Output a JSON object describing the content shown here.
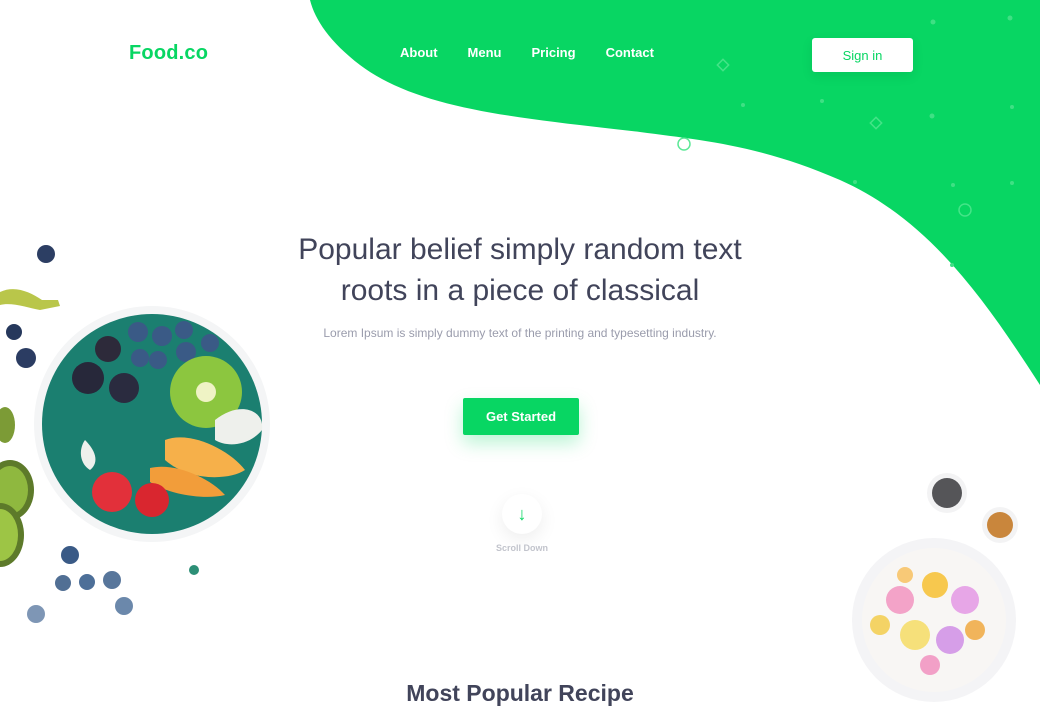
{
  "theme": {
    "accent": "#08d663"
  },
  "brand": {
    "logo": "Food.co"
  },
  "nav": {
    "items": [
      {
        "label": "About"
      },
      {
        "label": "Menu"
      },
      {
        "label": "Pricing"
      },
      {
        "label": "Contact"
      }
    ],
    "signin": "Sign in"
  },
  "hero": {
    "title_line1": "Popular belief simply random text",
    "title_line2": "roots in a piece of classical",
    "subtitle": "Lorem Ipsum is simply dummy text of the printing and typesetting industry.",
    "cta": "Get Started",
    "scroll_icon": "arrow-down-icon",
    "scroll_label": "Scroll Down"
  },
  "section": {
    "title": "Most Popular Recipe"
  }
}
